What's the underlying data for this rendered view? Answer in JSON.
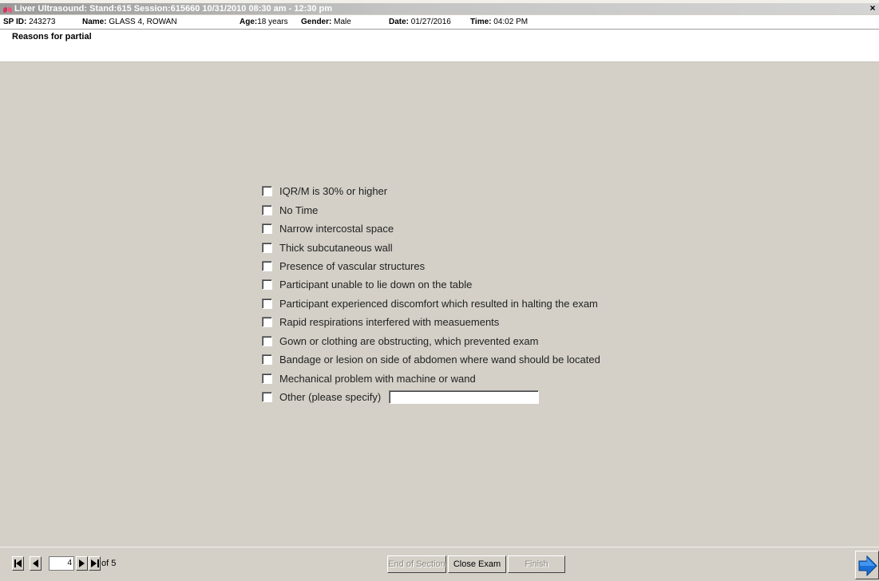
{
  "window": {
    "title": "Liver Ultrasound: Stand:615 Session:615660 10/31/2010 08:30 am - 12:30 pm",
    "app_icon": "lungs-icon",
    "close_icon": "close-icon",
    "close_glyph": "×"
  },
  "participant": {
    "sp_id_label": "SP ID:",
    "sp_id": "243273",
    "name_label": "Name:",
    "name": "GLASS 4, ROWAN",
    "age_label": "Age:",
    "age": "18 years",
    "gender_label": "Gender:",
    "gender": "Male",
    "date_label": "Date:",
    "date": "01/27/2016",
    "time_label": "Time:",
    "time": "04:02 PM"
  },
  "section": {
    "title": "Reasons for partial"
  },
  "reasons": [
    "IQR/M is 30% or higher",
    "No Time",
    "Narrow intercostal space",
    "Thick subcutaneous wall",
    "Presence of vascular structures",
    "Participant unable to lie down on the table",
    "Participant experienced discomfort which resulted in halting the exam",
    "Rapid respirations interfered with measuements",
    "Gown or clothing are obstructing, which prevented exam",
    "Bandage or lesion on side of abdomen where wand should be located",
    "Mechanical problem with machine or wand",
    "Other (please specify)"
  ],
  "other_field": {
    "value": ""
  },
  "navigation": {
    "current_page": "4",
    "of_label": "of 5",
    "icons": [
      "first-page-icon",
      "previous-page-icon",
      "next-page-icon",
      "last-page-icon"
    ]
  },
  "actions": {
    "end_of_section": "End of Section",
    "close_exam": "Close Exam",
    "finish": "Finish"
  },
  "colors": {
    "window_bg": "#d4d0c8",
    "info_bg": "#ffffff",
    "next_arrow": "#1a6fd6"
  }
}
